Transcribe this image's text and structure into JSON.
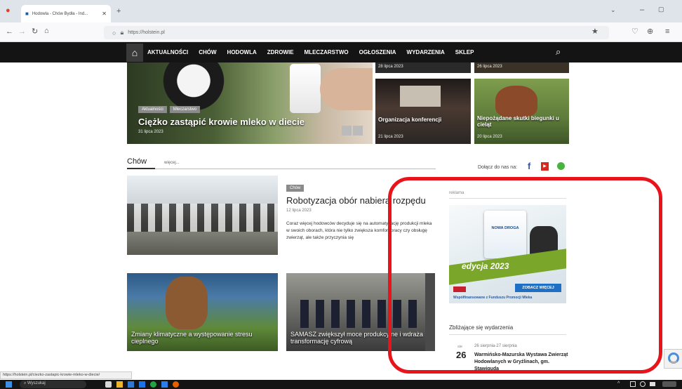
{
  "browser": {
    "tab_title": "Hodowla - Chów Bydła - Ind...",
    "url": "https://holstein.pl",
    "status_url": "https://holstein.pl/ciezko-zastapic-krowie-mleko-w-diecie/"
  },
  "nav": {
    "items": [
      "AKTUALNOŚCI",
      "CHÓW",
      "HODOWLA",
      "ZDROWIE",
      "MLECZARSTWO",
      "OGŁOSZENIA",
      "WYDARZENIA",
      "SKLEP"
    ]
  },
  "hero": {
    "tag1": "Aktualności",
    "tag2": "Mleczarstwo",
    "title": "Ciężko zastąpić krowie mleko w diecie",
    "date": "31 lipca 2023"
  },
  "side_cards": [
    {
      "date": "28 lipca 2023"
    },
    {
      "date": "26 lipca 2023"
    },
    {
      "title": "Organizacja konferencji",
      "date": "21 lipca 2023"
    },
    {
      "title": "Niepożądane skutki biegunki u cieląt",
      "date": "20 lipca 2023"
    }
  ],
  "section": {
    "title": "Chów",
    "more": "więcej..."
  },
  "social": {
    "label": "Dołącz do nas na:"
  },
  "article": {
    "tag": "Chów",
    "title": "Robotyzacja obór nabiera rozpędu",
    "date": "12 lipca 2023",
    "excerpt": "Coraz więcej hodowców decyduje się na automatyzację produkcji mleka w swoich oborach, która nie tylko zwiększa komfort pracy czy obsługę zwierząt, ale także przyczynia się"
  },
  "bottom_cards": [
    {
      "title": "Zmiany klimatyczne a występowanie stresu cieplnego"
    },
    {
      "title": "SAMASZ zwiększył moce produkcyjne i wdraża transformację cyfrową"
    }
  ],
  "ad": {
    "label": "reklama",
    "brand": "NOWA DROGA",
    "edition": "edycja 2023",
    "cta": "ZOBACZ WIĘCEJ",
    "footer": "Współfinansowane z Funduszu Promocji Mleka"
  },
  "events": {
    "heading": "Zbliżające się wydarzenia",
    "month": "sie",
    "day": "26",
    "range": "26 sierpnia-27 sierpnia",
    "title": "Warmińsko-Mazurska Wystawa Zwierząt Hodowlanych w Gryźlinach, gm. Stawiguda"
  },
  "taskbar": {
    "search": "Wyszukaj"
  },
  "colors": {
    "highlight": "#e8141c",
    "nav_bg": "#141414",
    "ad_green": "#7aa62a"
  }
}
